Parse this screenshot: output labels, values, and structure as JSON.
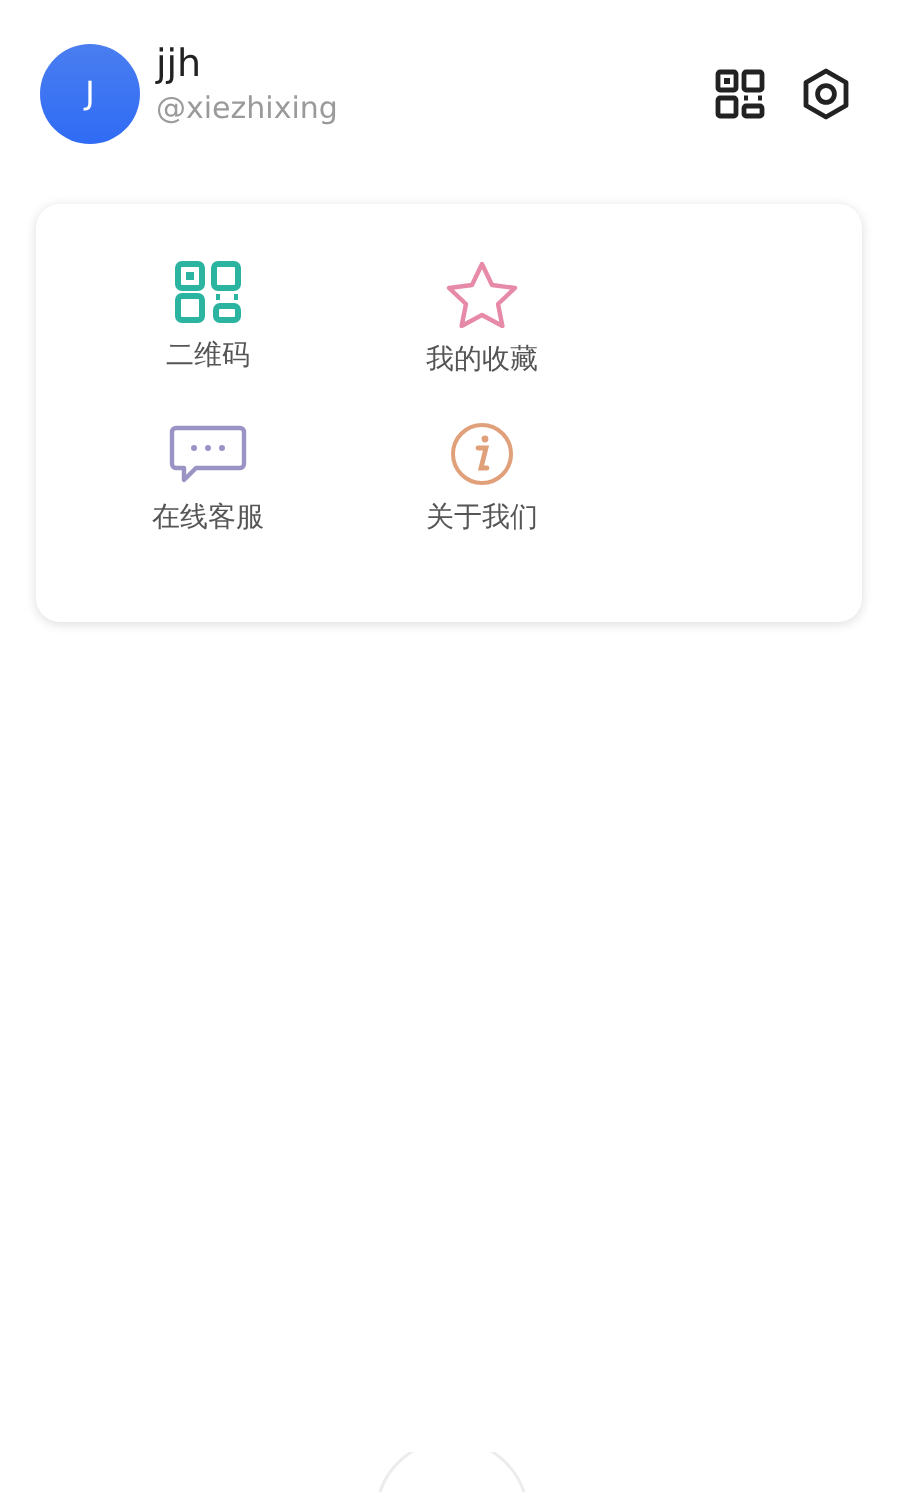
{
  "profile": {
    "avatar_letter": "J",
    "name": "jjh",
    "handle": "@xiezhixing"
  },
  "menu": [
    {
      "kind": "qrcode",
      "label": "二维码",
      "color": "#2bb5a0"
    },
    {
      "kind": "star",
      "label": "我的收藏",
      "color": "#e68aa8"
    },
    {
      "kind": "chat",
      "label": "在线客服",
      "color": "#9a94c4"
    },
    {
      "kind": "info",
      "label": "关于我们",
      "color": "#e0a07a"
    }
  ]
}
